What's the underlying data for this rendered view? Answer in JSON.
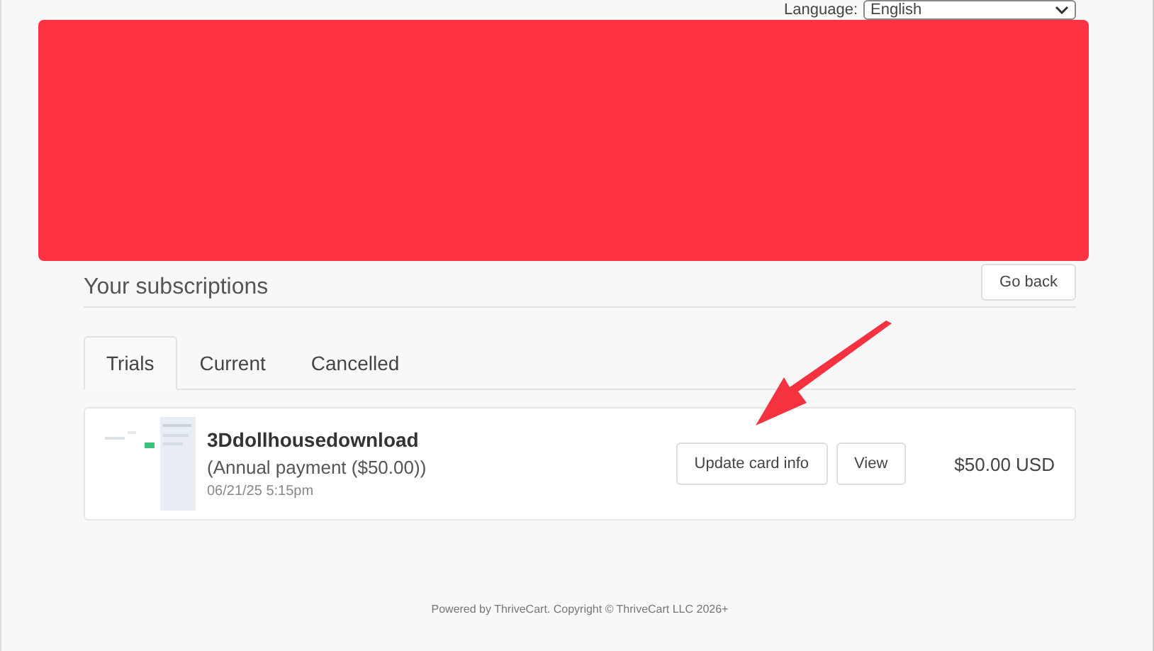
{
  "language": {
    "label": "Language:",
    "value": "English"
  },
  "heading": "Your subscriptions",
  "back_button": "Go back",
  "tabs": [
    {
      "label": "Trials",
      "selected": true
    },
    {
      "label": "Current",
      "selected": false
    },
    {
      "label": "Cancelled",
      "selected": false
    }
  ],
  "subscriptions": [
    {
      "thumbnail": {
        "kind": "picture"
      },
      "name": "3Ddollhousedownload",
      "plan": "(Annual payment ($50.00))",
      "date": "06/21/25 5:15pm",
      "buttons": [
        "Update card info",
        "View"
      ],
      "price": "$50.00 USD"
    }
  ],
  "footer": "Powered by ThriveCart. Copyright © ThriveCart LLC 2026+"
}
